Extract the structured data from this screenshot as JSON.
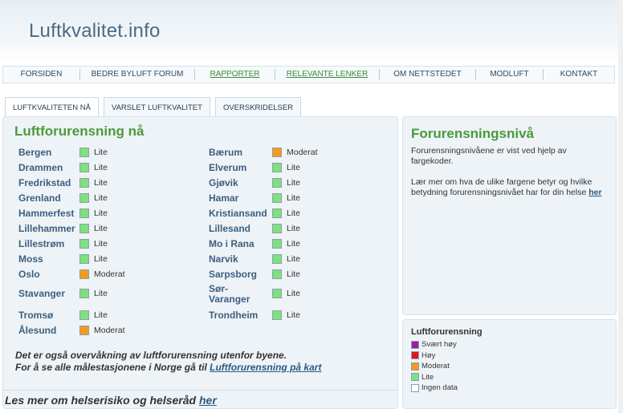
{
  "site": {
    "title": "Luftkvalitet.info"
  },
  "nav": {
    "items": [
      {
        "label": "FORSIDEN",
        "active": false
      },
      {
        "label": "BEDRE BYLUFT FORUM",
        "active": false
      },
      {
        "label": "RAPPORTER",
        "active": false
      },
      {
        "label": "RELEVANTE LENKER",
        "active": true
      },
      {
        "label": "OM NETTSTEDET",
        "active": false
      },
      {
        "label": "MODLUFT",
        "active": false
      },
      {
        "label": "KONTAKT",
        "active": false
      }
    ]
  },
  "tabs": [
    {
      "label": "LUFTKVALITETEN NÅ",
      "active": true
    },
    {
      "label": "VARSLET LUFTKVALITET",
      "active": false
    },
    {
      "label": "OVERSKRIDELSER",
      "active": false
    }
  ],
  "main": {
    "heading": "Luftforurensning nå",
    "cities_left": [
      {
        "name": "Bergen",
        "level": "Lite",
        "color": "#7ee07e"
      },
      {
        "name": "Drammen",
        "level": "Lite",
        "color": "#7ee07e"
      },
      {
        "name": "Fredrikstad",
        "level": "Lite",
        "color": "#7ee07e"
      },
      {
        "name": "Grenland",
        "level": "Lite",
        "color": "#7ee07e"
      },
      {
        "name": "Hammerfest",
        "level": "Lite",
        "color": "#7ee07e"
      },
      {
        "name": "Lillehammer",
        "level": "Lite",
        "color": "#7ee07e"
      },
      {
        "name": "Lillestrøm",
        "level": "Lite",
        "color": "#7ee07e"
      },
      {
        "name": "Moss",
        "level": "Lite",
        "color": "#7ee07e"
      },
      {
        "name": "Oslo",
        "level": "Moderat",
        "color": "#f59a1c"
      },
      {
        "name": "Stavanger",
        "level": "Lite",
        "color": "#7ee07e"
      },
      {
        "name": "Tromsø",
        "level": "Lite",
        "color": "#7ee07e"
      },
      {
        "name": "Ålesund",
        "level": "Moderat",
        "color": "#f59a1c"
      }
    ],
    "cities_right": [
      {
        "name": "Bærum",
        "level": "Moderat",
        "color": "#f59a1c"
      },
      {
        "name": "Elverum",
        "level": "Lite",
        "color": "#7ee07e"
      },
      {
        "name": "Gjøvik",
        "level": "Lite",
        "color": "#7ee07e"
      },
      {
        "name": "Hamar",
        "level": "Lite",
        "color": "#7ee07e"
      },
      {
        "name": "Kristiansand",
        "level": "Lite",
        "color": "#7ee07e"
      },
      {
        "name": "Lillesand",
        "level": "Lite",
        "color": "#7ee07e"
      },
      {
        "name": "Mo i Rana",
        "level": "Lite",
        "color": "#7ee07e"
      },
      {
        "name": "Narvik",
        "level": "Lite",
        "color": "#7ee07e"
      },
      {
        "name": "Sarpsborg",
        "level": "Lite",
        "color": "#7ee07e"
      },
      {
        "name": "Sør-Varanger",
        "level": "Lite",
        "color": "#7ee07e"
      },
      {
        "name": "Trondheim",
        "level": "Lite",
        "color": "#7ee07e"
      }
    ],
    "note_line1": "Det er også overvåkning av luftforurensning utenfor byene.",
    "note_line2": "For å se alle målestasjonene i Norge gå til",
    "note_link": "Luftforurensning på kart",
    "more_text": "Les mer om helserisiko og helseråd",
    "more_link": "her"
  },
  "info": {
    "heading": "Forurensningsnivå",
    "text1": "Forurensningsnivåene er vist ved hjelp av fargekoder.",
    "text2": "Lær mer om hva de ulike fargene betyr og hvilke betydning forurensningsnivået har for din helse",
    "link": "her"
  },
  "legend": {
    "heading": "Luftforurensning",
    "items": [
      {
        "label": "Svært høy",
        "color": "#9b1fa0"
      },
      {
        "label": "Høy",
        "color": "#e3141b"
      },
      {
        "label": "Moderat",
        "color": "#f59a1c"
      },
      {
        "label": "Lite",
        "color": "#7ee07e"
      },
      {
        "label": "Ingen data",
        "color": "#ffffff"
      }
    ]
  }
}
